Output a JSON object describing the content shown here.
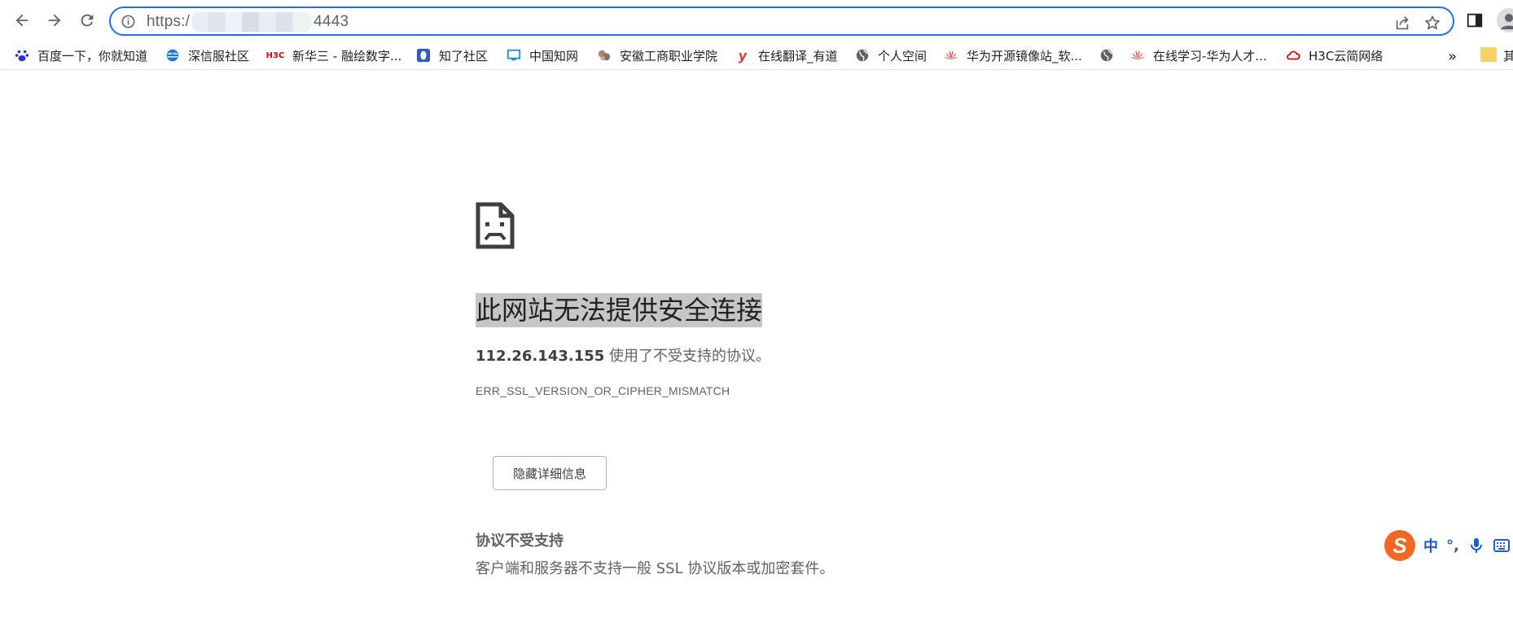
{
  "browser": {
    "url_prefix": "https:/",
    "url_port": "4443",
    "bookmarks": [
      {
        "label": "百度一下，你就知道",
        "icon": "baidu-paw-icon",
        "color": "#2932e1"
      },
      {
        "label": "深信服社区",
        "icon": "globe-icon",
        "color": "#1a73e8"
      },
      {
        "label": "新华三 - 融绘数字...",
        "icon": "h3c-logo-icon",
        "color": "#d7000f"
      },
      {
        "label": "知了社区",
        "icon": "zhiliao-icon",
        "color": "#2d5fb5"
      },
      {
        "label": "中国知网",
        "icon": "monitor-icon",
        "color": "#1e88e5"
      },
      {
        "label": "安徽工商职业学院",
        "icon": "school-badge-icon",
        "color": "#8d6e63"
      },
      {
        "label": "在线翻译_有道",
        "icon": "youdao-icon",
        "color": "#e53935"
      },
      {
        "label": "个人空间",
        "icon": "globe-icon",
        "color": "#5f6368"
      },
      {
        "label": "华为开源镜像站_软...",
        "icon": "huawei-icon",
        "color": "#e53935"
      },
      {
        "label": "",
        "icon": "globe-icon",
        "color": "#5f6368"
      },
      {
        "label": "在线学习-华为人才...",
        "icon": "huawei-icon",
        "color": "#e53935"
      },
      {
        "label": "H3C云简网络",
        "icon": "cloud-icon",
        "color": "#d7000f"
      }
    ],
    "more_label": "»",
    "folder_label": "其"
  },
  "page": {
    "title": "此网站无法提供安全连接",
    "ip": "112.26.143.155",
    "desc_suffix": " 使用了不受支持的协议。",
    "error_code": "ERR_SSL_VERSION_OR_CIPHER_MISMATCH",
    "details_button": "隐藏详细信息",
    "details_title": "协议不受支持",
    "details_desc": "客户端和服务器不支持一般 SSL 协议版本或加密套件。"
  },
  "ime": {
    "logo": "S",
    "mode": "中",
    "punct": "°,"
  }
}
